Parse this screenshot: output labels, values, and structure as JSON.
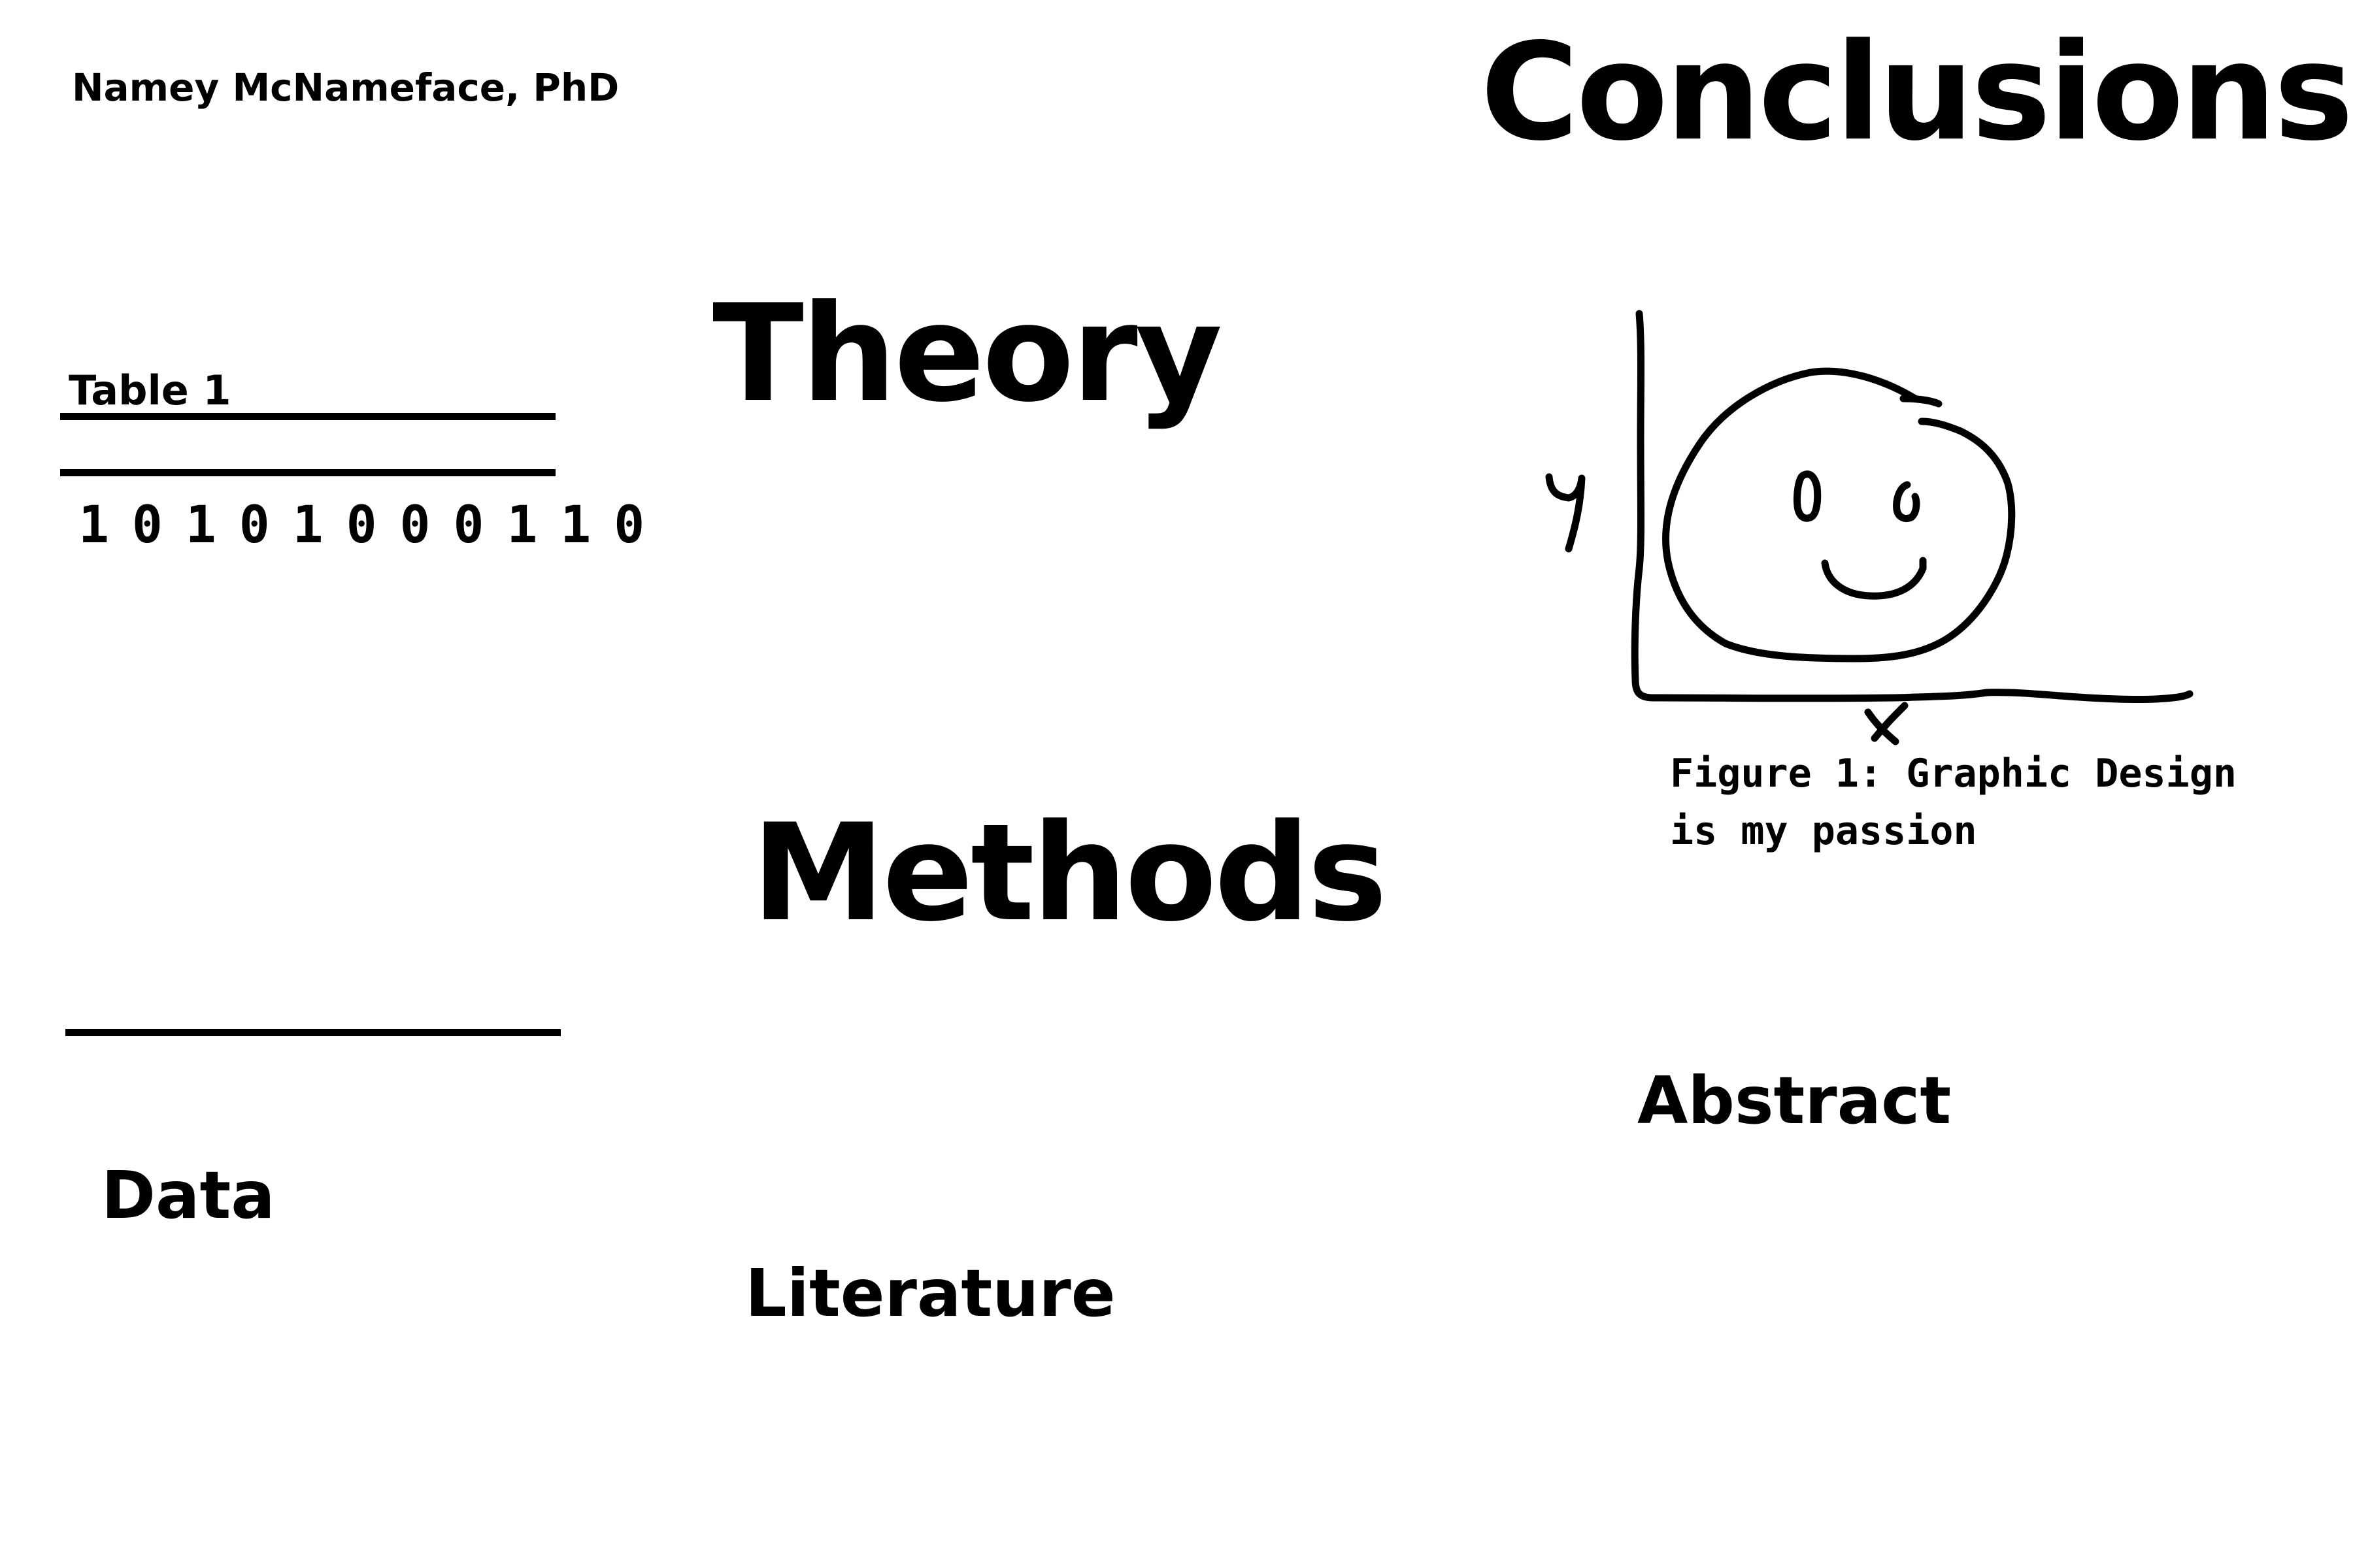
{
  "author": "Namey McNameface, PhD",
  "sections": {
    "conclusions": "Conclusions",
    "theory": "Theory",
    "methods": "Methods",
    "abstract": "Abstract",
    "data": "Data",
    "literature": "Literature"
  },
  "table": {
    "label": "Table 1",
    "digits": "1 0 1 0 1 0 0 0 1 1 0"
  },
  "figure": {
    "y_label": "y",
    "x_label": "x",
    "caption_line1": "Figure 1: Graphic Design",
    "caption_line2": "is my passion"
  },
  "colors": {
    "ink": "#000000",
    "paper": "#ffffff"
  }
}
